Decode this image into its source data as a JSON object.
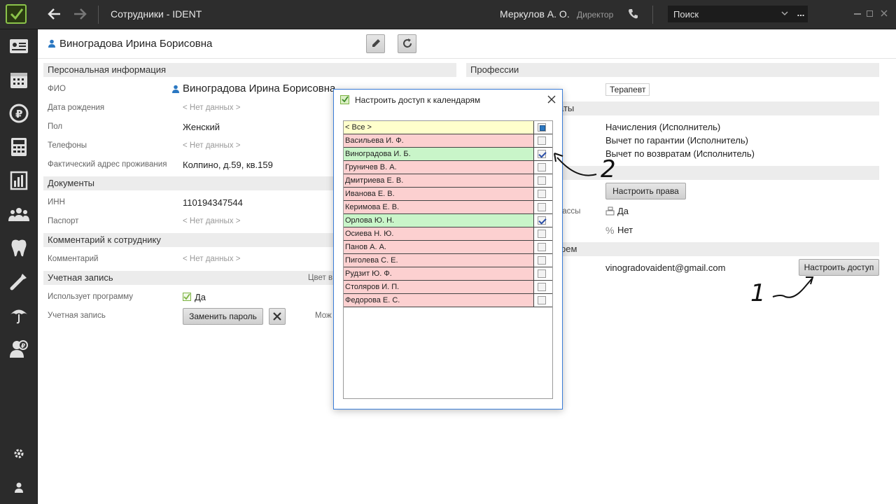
{
  "topbar": {
    "title": "Сотрудники - IDENT",
    "user_name": "Меркулов А. О.",
    "user_role": "Директор",
    "search_placeholder": "Поиск",
    "search_more": "..."
  },
  "header": {
    "employee_name": "Виноградова Ирина Борисовна"
  },
  "personal": {
    "section_title": "Персональная информация",
    "fio_label": "ФИО",
    "fio_value": "Виноградова Ирина Борисовна",
    "birth_label": "Дата рождения",
    "birth_value": "< Нет данных >",
    "gender_label": "Пол",
    "gender_value": "Женский",
    "phones_label": "Телефоны",
    "phones_value": "< Нет данных >",
    "address_label": "Фактический адрес проживания",
    "address_value": "Колпино, д.59, кв.159"
  },
  "documents": {
    "section_title": "Документы",
    "inn_label": "ИНН",
    "inn_value": "110194347544",
    "passport_label": "Паспорт",
    "passport_value": "< Нет данных >"
  },
  "comment": {
    "section_title": "Комментарий к сотруднику",
    "comment_label": "Комментарий",
    "comment_value": "< Нет данных >"
  },
  "account": {
    "section_title": "Учетная запись",
    "color_label": "Цвет в",
    "uses_program_label": "Использует программу",
    "uses_program_value": "Да",
    "account_label": "Учетная запись",
    "change_password_label": "Заменить пароль",
    "mozh_label": "Мож"
  },
  "right": {
    "professions_title": "Профессии",
    "profession_tag": "Терапевт",
    "payments_title_partial": "аты",
    "payment_items": [
      "Начисления (Исполнитель)",
      "Вычет по гарантии (Исполнитель)",
      "Вычет по возвратам (Исполнитель)"
    ],
    "configure_rights_label": "Настроить права",
    "cash_label_partial": "кассы",
    "cash_value": "Да",
    "percent_value": "Нет",
    "calendar_title_partial": "рем",
    "email": "vinogradovaident@gmail.com",
    "configure_access_label": "Настроить доступ"
  },
  "dialog": {
    "title": "Настроить доступ к календарям",
    "rows": [
      {
        "name": "< Все >",
        "state": "partial",
        "color": "yellow"
      },
      {
        "name": "Васильева И. Ф.",
        "state": "off",
        "color": "red"
      },
      {
        "name": "Виноградова И. Б.",
        "state": "on",
        "color": "green"
      },
      {
        "name": "Груничев В. А.",
        "state": "off",
        "color": "red"
      },
      {
        "name": "Дмитриева Е. В.",
        "state": "off",
        "color": "red"
      },
      {
        "name": "Иванова Е. В.",
        "state": "off",
        "color": "red"
      },
      {
        "name": "Керимова Е. В.",
        "state": "off",
        "color": "red"
      },
      {
        "name": "Орлова Ю. Н.",
        "state": "on",
        "color": "green"
      },
      {
        "name": "Осиева Н. Ю.",
        "state": "off",
        "color": "red"
      },
      {
        "name": "Панов А. А.",
        "state": "off",
        "color": "red"
      },
      {
        "name": "Пиголева С. Е.",
        "state": "off",
        "color": "red"
      },
      {
        "name": "Рудзит Ю. Ф.",
        "state": "off",
        "color": "red"
      },
      {
        "name": "Столяров И. П.",
        "state": "off",
        "color": "red"
      },
      {
        "name": "Федорова Е. С.",
        "state": "off",
        "color": "red"
      }
    ]
  },
  "annotations": {
    "mark_1": "1",
    "mark_2": "2"
  },
  "colors": {
    "accent_green": "#8bc34a",
    "row_red": "#fcd0d0",
    "row_green": "#c9f5c9",
    "row_yellow": "#ffffcc",
    "dialog_border": "#3b7dd8"
  }
}
